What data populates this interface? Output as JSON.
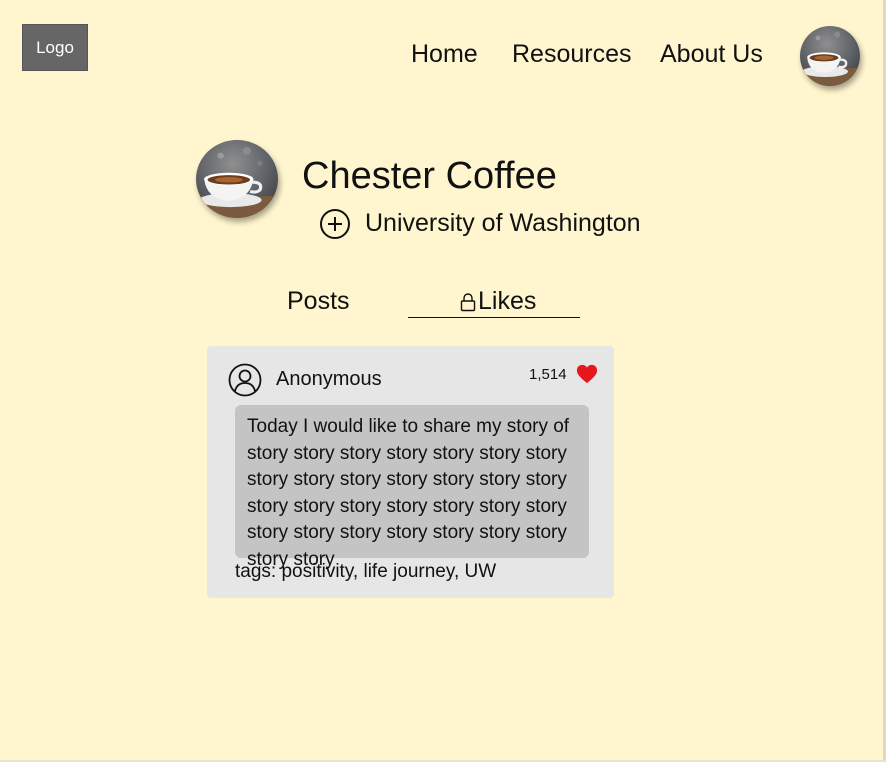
{
  "header": {
    "logo_text": "Logo",
    "nav": {
      "home": "Home",
      "resources": "Resources",
      "about": "About Us"
    }
  },
  "profile": {
    "name": "Chester Coffee",
    "school": "University of Washington",
    "avatar_icon": "coffee-cup-photo"
  },
  "tabs": {
    "posts": "Posts",
    "likes": "Likes"
  },
  "post": {
    "author": "Anonymous",
    "like_count": "1,514",
    "body": "Today I would like to share my story of story story story story story story story story story story story story story story story story story story story story story story story story story story story story story story",
    "tags": "tags: positivity, life journey, UW"
  },
  "colors": {
    "background": "#FFF6CF",
    "logo_bg": "#666666",
    "card_bg": "#E6E6E6",
    "post_body_bg": "#C4C4C4",
    "heart": "#E8161D"
  }
}
